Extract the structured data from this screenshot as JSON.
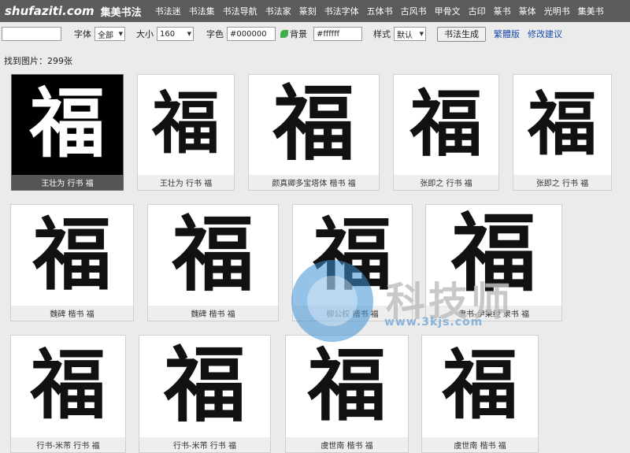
{
  "header": {
    "logo": "shufaziti.com",
    "logo_cn": "集美书法",
    "nav": [
      "书法迷",
      "书法集",
      "书法导航",
      "书法家",
      "篆刻",
      "书法字体",
      "五体书",
      "古风书",
      "甲骨文",
      "古印",
      "篆书",
      "篆体",
      "光明书",
      "集美书"
    ]
  },
  "toolbar": {
    "text_value": "",
    "font_label": "字体",
    "font_value": "全部",
    "size_label": "大小",
    "size_value": "160",
    "color_label": "字色",
    "color_value": "#000000",
    "bg_label": "背景",
    "bg_value": "#ffffff",
    "style_label": "样式",
    "style_value": "默认",
    "generate_button": "书法生成",
    "traditional_link": "繁體版",
    "feedback_link": "修改建议"
  },
  "results": {
    "count_text": "找到图片：299张",
    "items": [
      {
        "char": "福",
        "caption": "王壮为 行书 福",
        "dark": true
      },
      {
        "char": "福",
        "caption": "王壮为 行书 福",
        "dark": false
      },
      {
        "char": "福",
        "caption": "颜真卿多宝塔体 楷书 福",
        "dark": false
      },
      {
        "char": "福",
        "caption": "张即之 行书 福",
        "dark": false
      },
      {
        "char": "福",
        "caption": "张即之 行书 福",
        "dark": false
      },
      {
        "char": "福",
        "caption": "魏碑 楷书 福",
        "dark": false
      },
      {
        "char": "福",
        "caption": "魏碑 楷书 福",
        "dark": false
      },
      {
        "char": "福",
        "caption": "柳公权 楷书 福",
        "dark": false
      },
      {
        "char": "福",
        "caption": "隶书-伊秉绶 隶书 福",
        "dark": false
      },
      {
        "char": "福",
        "caption": "行书-米芾 行书 福",
        "dark": false
      },
      {
        "char": "福",
        "caption": "行书-米芾 行书 福",
        "dark": false
      },
      {
        "char": "福",
        "caption": "虞世南 楷书 福",
        "dark": false
      },
      {
        "char": "福",
        "caption": "虞世南 楷书 福",
        "dark": false
      }
    ]
  },
  "watermark": {
    "text": "科技师",
    "url": "www.3kjs.com"
  }
}
